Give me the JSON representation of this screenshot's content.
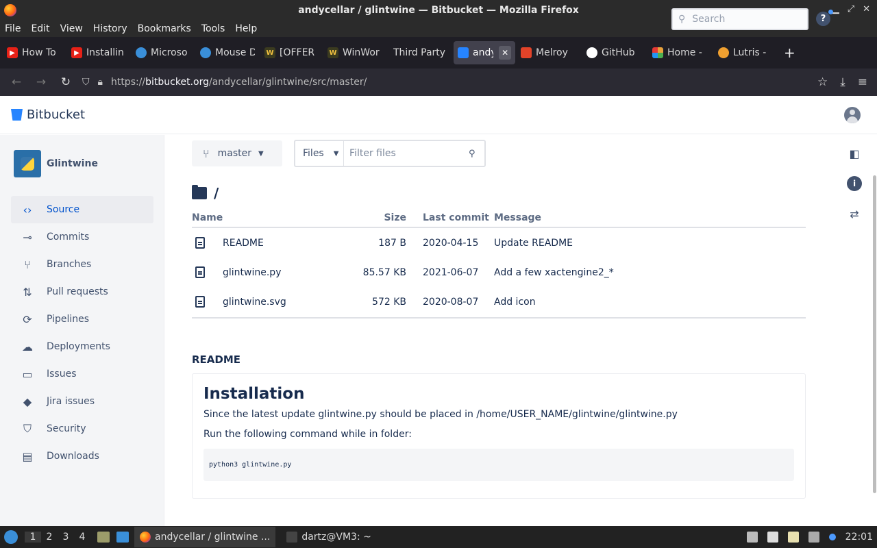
{
  "window": {
    "title": "andycellar / glintwine — Bitbucket — Mozilla Firefox"
  },
  "menu": [
    "File",
    "Edit",
    "View",
    "History",
    "Bookmarks",
    "Tools",
    "Help"
  ],
  "tabs": [
    {
      "label": "How To",
      "icon_color": "#e62117",
      "icon": "youtube-icon"
    },
    {
      "label": "Installin",
      "icon_color": "#e62117",
      "icon": "youtube-icon"
    },
    {
      "label": "Microso",
      "icon_color": "#3a8fd9",
      "icon": "edge-icon"
    },
    {
      "label": "Mouse D",
      "icon_color": "#3a8fd9",
      "icon": "edge-icon"
    },
    {
      "label": "[OFFER",
      "icon_color": "#3b3b1f",
      "icon": "winworld-icon"
    },
    {
      "label": "WinWor",
      "icon_color": "#3b3b1f",
      "icon": "winworld-icon"
    },
    {
      "label": "Third Party",
      "icon_color": "",
      "icon": ""
    },
    {
      "label": "andy",
      "icon_color": "#2684ff",
      "icon": "bitbucket-icon",
      "active": true
    },
    {
      "label": "Melroy",
      "icon_color": "#e24329",
      "icon": "gitlab-icon"
    },
    {
      "label": "GitHub",
      "icon_color": "#ffffff",
      "icon": "github-icon"
    },
    {
      "label": "Home -",
      "icon_color": "#e9a23b",
      "icon": "pinwheel-icon"
    },
    {
      "label": "Lutris -",
      "icon_color": "#f0a030",
      "icon": "lutris-icon"
    }
  ],
  "nav": {
    "url_prefix": "https://",
    "url_host": "bitbucket.org",
    "url_path": "/andycellar/glintwine/src/master/"
  },
  "header": {
    "brand": "Bitbucket",
    "search_placeholder": "Search"
  },
  "sidebar": {
    "repo_name": "Glintwine",
    "items": [
      {
        "label": "Source",
        "icon": "code-icon",
        "active": true
      },
      {
        "label": "Commits",
        "icon": "commit-icon"
      },
      {
        "label": "Branches",
        "icon": "branch-icon"
      },
      {
        "label": "Pull requests",
        "icon": "pull-request-icon"
      },
      {
        "label": "Pipelines",
        "icon": "pipelines-icon"
      },
      {
        "label": "Deployments",
        "icon": "cloud-upload-icon"
      },
      {
        "label": "Issues",
        "icon": "issues-icon"
      },
      {
        "label": "Jira issues",
        "icon": "jira-icon"
      },
      {
        "label": "Security",
        "icon": "shield-icon"
      },
      {
        "label": "Downloads",
        "icon": "download-icon"
      }
    ]
  },
  "toolbar": {
    "branch": "master",
    "files_dropdown": "Files",
    "filter_placeholder": "Filter files"
  },
  "path": "/",
  "files": {
    "headers": {
      "name": "Name",
      "size": "Size",
      "last_commit": "Last commit",
      "message": "Message"
    },
    "rows": [
      {
        "name": "README",
        "size": "187 B",
        "last_commit": "2020-04-15",
        "message": "Update README"
      },
      {
        "name": "glintwine.py",
        "size": "85.57 KB",
        "last_commit": "2021-06-07",
        "message": "Add a few xactengine2_*"
      },
      {
        "name": "glintwine.svg",
        "size": "572 KB",
        "last_commit": "2020-08-07",
        "message": "Add icon"
      }
    ]
  },
  "readme": {
    "section_title": "README",
    "heading": "Installation",
    "para1": "Since the latest update glintwine.py should be placed in /home/USER_NAME/glintwine/glintwine.py",
    "para2": "Run the following command while in folder:",
    "code": "python3 glintwine.py"
  },
  "taskbar": {
    "workspaces": [
      "1",
      "2",
      "3",
      "4"
    ],
    "active_workspace": "1",
    "tasks": [
      {
        "label": "andycellar / glintwine ...",
        "active": true
      },
      {
        "label": "dartz@VM3: ~",
        "active": false
      }
    ],
    "clock": "22:01"
  },
  "colors": {
    "accent": "#0052cc",
    "brand": "#2684ff",
    "text": "#172b4d"
  }
}
